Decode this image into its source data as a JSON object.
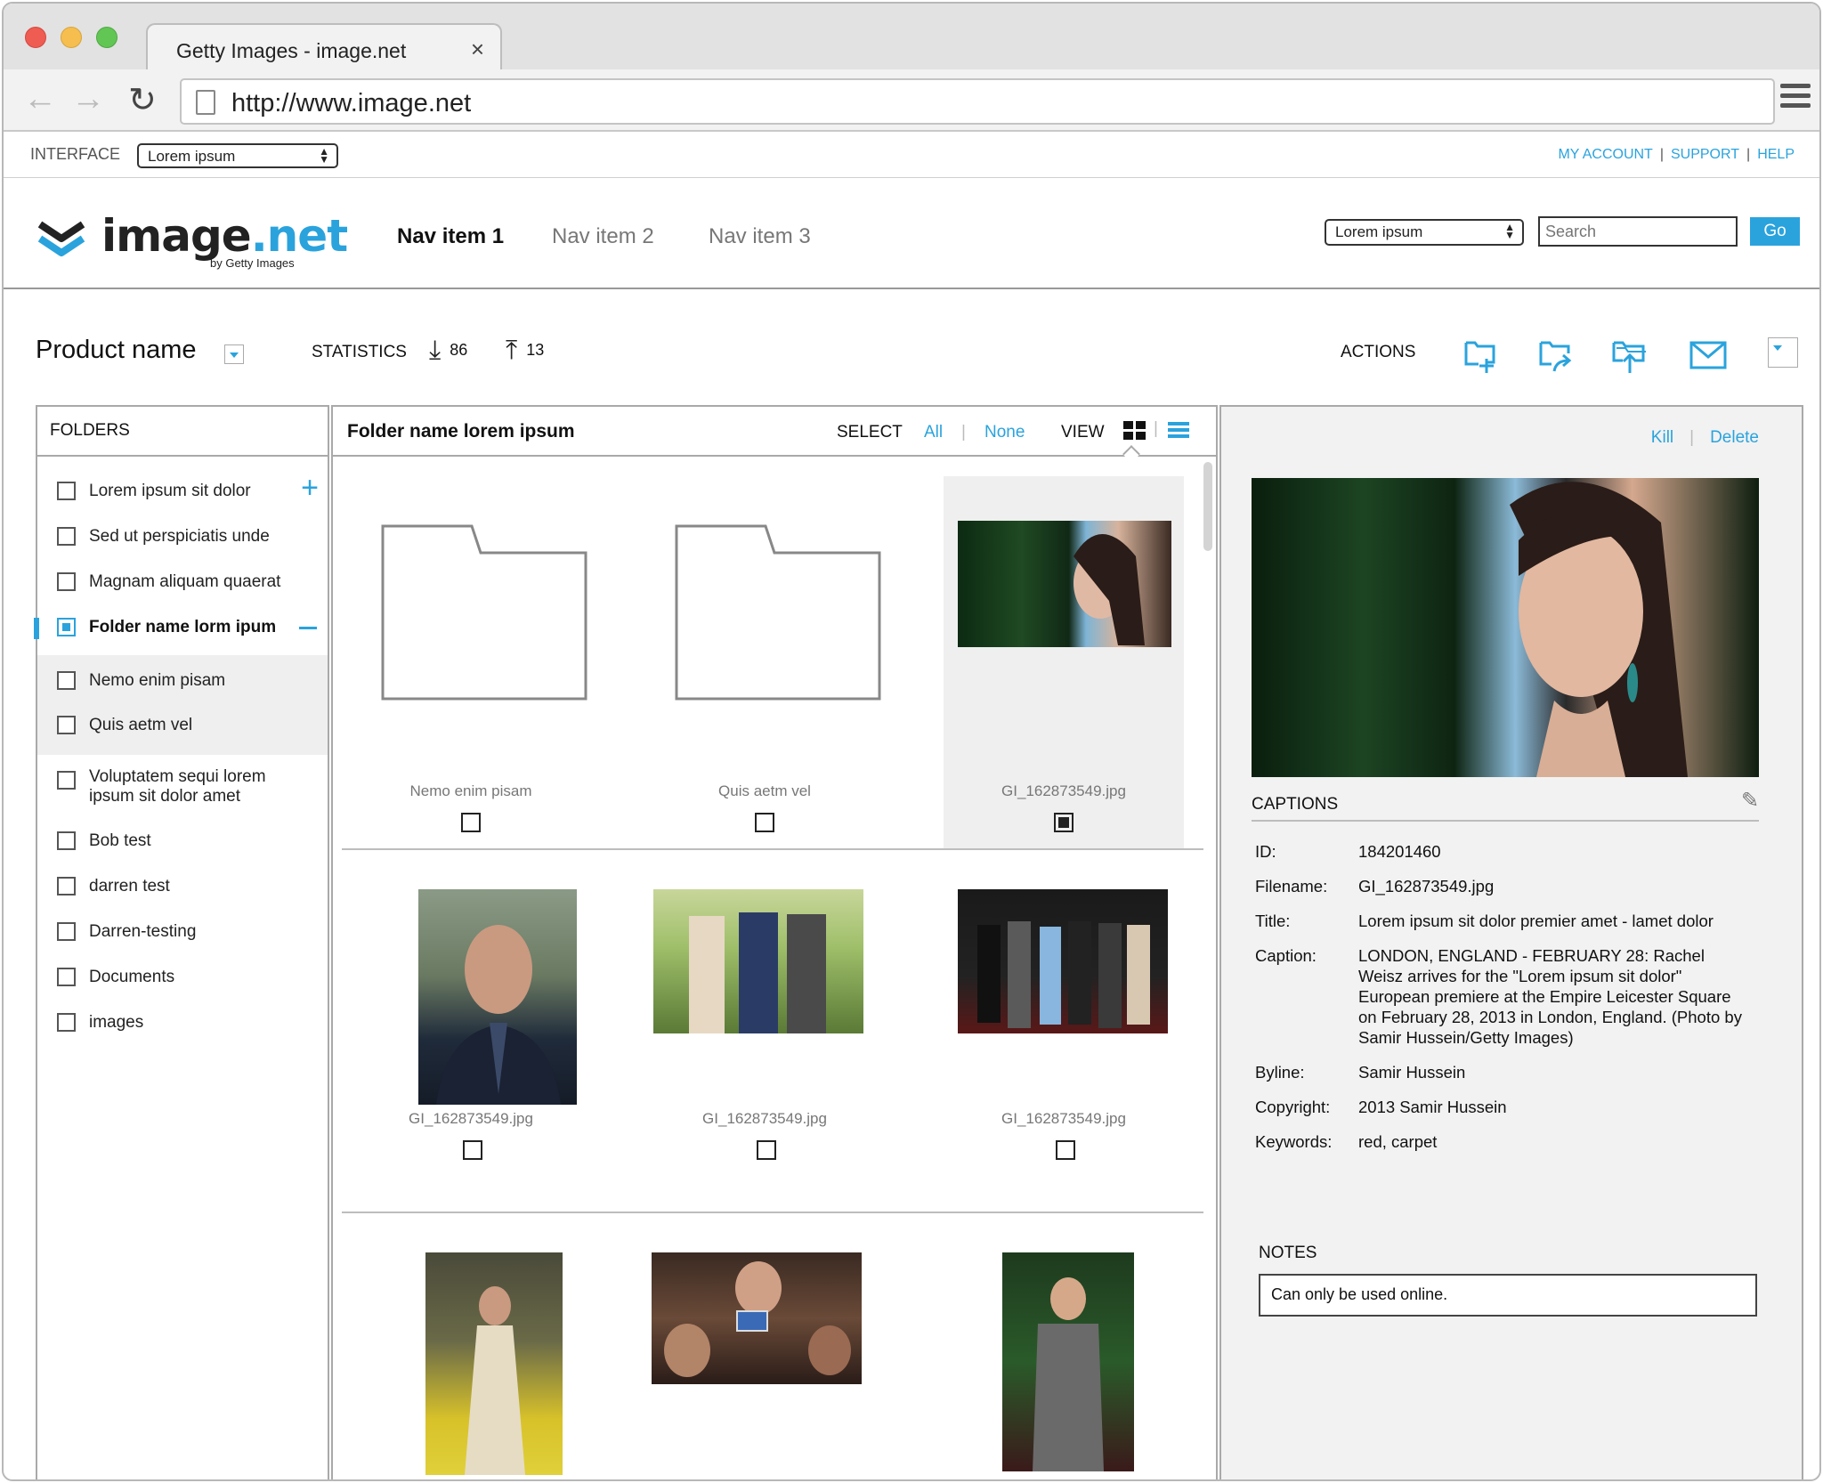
{
  "browser": {
    "tab_title": "Getty Images - image.net",
    "tab_close": "×",
    "url": "http://www.image.net"
  },
  "utility": {
    "interface_label": "INTERFACE",
    "interface_select": "Lorem ipsum",
    "links": [
      "MY ACCOUNT",
      "SUPPORT",
      "HELP"
    ]
  },
  "header": {
    "logo_main": "image",
    "logo_accent": ".net",
    "logo_sub": "by Getty Images",
    "nav": [
      {
        "label": "Nav item 1",
        "active": true
      },
      {
        "label": "Nav item 2",
        "active": false
      },
      {
        "label": "Nav item 3",
        "active": false
      }
    ],
    "search_select": "Lorem ipsum",
    "search_placeholder": "Search",
    "go_label": "Go"
  },
  "product": {
    "name": "Product name",
    "statistics_label": "STATISTICS",
    "downloads": "86",
    "uploads": "13",
    "actions_label": "ACTIONS"
  },
  "folders": {
    "title": "FOLDERS",
    "items": [
      "Lorem ipsum sit dolor",
      "Sed ut perspiciatis unde",
      "Magnam aliquam quaerat",
      "Folder name lorm ipum",
      "Nemo enim pisam",
      "Quis aetm vel",
      "Voluptatem sequi lorem ipsum sit dolor amet",
      "Bob test",
      "darren test",
      "Darren-testing",
      "Documents",
      "images"
    ]
  },
  "grid": {
    "title": "Folder name lorem ipsum",
    "select_label": "SELECT",
    "select_all": "All",
    "select_none": "None",
    "view_label": "VIEW",
    "cells": [
      "Nemo enim pisam",
      "Quis aetm vel",
      "GI_162873549.jpg",
      "GI_162873549.jpg",
      "GI_162873549.jpg",
      "GI_162873549.jpg"
    ]
  },
  "detail": {
    "kill": "Kill",
    "delete": "Delete",
    "captions_title": "CAPTIONS",
    "id_key": "ID:",
    "id": "184201460",
    "filename_key": "Filename:",
    "filename": "GI_162873549.jpg",
    "title_key": "Title:",
    "title": "Lorem ipsum sit dolor premier amet - lamet dolor",
    "caption_key": "Caption:",
    "caption": "LONDON, ENGLAND - FEBRUARY 28: Rachel Weisz arrives for the \"Lorem ipsum sit dolor\" European premiere at the Empire Leicester Square on February 28, 2013 in London, England. (Photo by Samir Hussein/Getty Images)",
    "byline_key": "Byline:",
    "byline": "Samir Hussein",
    "copyright_key": "Copyright:",
    "copyright": "2013 Samir Hussein",
    "keywords_key": "Keywords:",
    "keywords": "red, carpet",
    "notes_title": "NOTES",
    "notes": "Can only be used online."
  },
  "colors": {
    "accent": "#2aa3dd"
  }
}
